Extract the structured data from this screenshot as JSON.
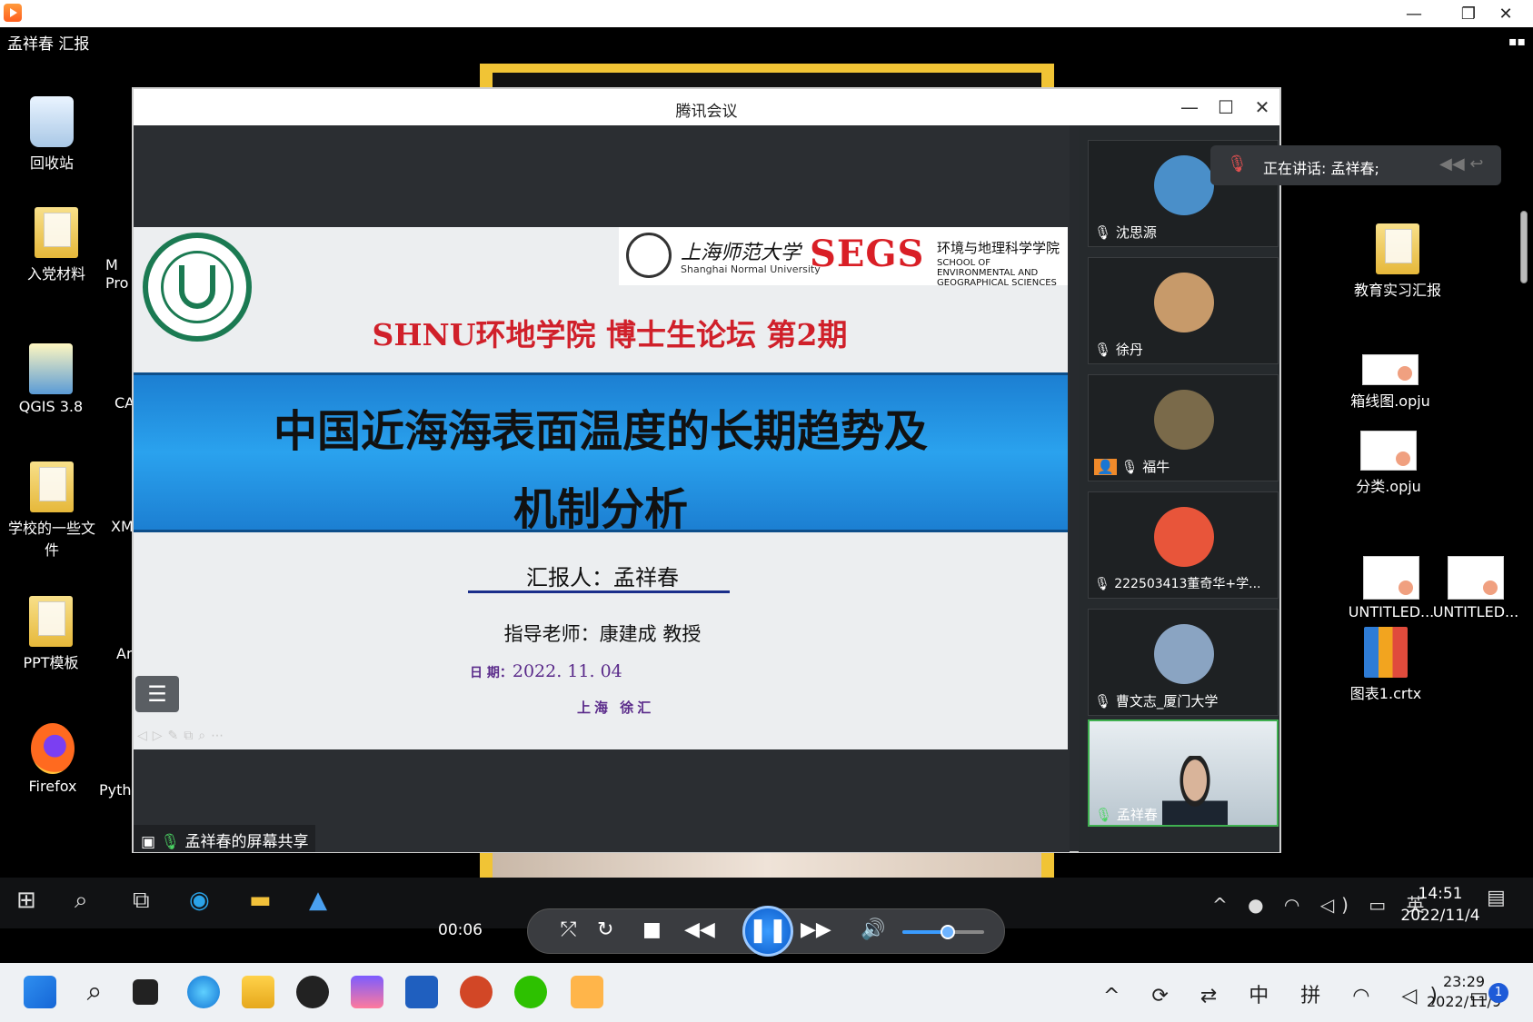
{
  "player": {
    "window_controls": [
      "—",
      "❐",
      "✕"
    ],
    "media_title": "孟祥春 汇报",
    "elapsed": "00:06",
    "volume_level": 0.55
  },
  "desktop": {
    "left_icons": [
      "回收站",
      "入党材料",
      "QGIS 3.8",
      "学校的一些文件",
      "PPT模板",
      "Firefox"
    ],
    "partial_icons": [
      "M\nPro",
      "CA",
      "XM",
      "Ar",
      "Pyth"
    ],
    "right_icons": [
      "教育实习汇报",
      "箱线图.opju",
      "分类.opju",
      "UNTITLED...",
      "UNTITLED...",
      "图表1.crtx"
    ]
  },
  "meeting": {
    "title": "腾讯会议",
    "window_controls": [
      "—",
      "☐",
      "✕"
    ],
    "share_status": "孟祥春的屏幕共享",
    "speaking": "正在讲话: 孟祥春;",
    "participants": [
      {
        "name": "沈思源",
        "avatar_color": "#4a8fc9"
      },
      {
        "name": "徐丹",
        "avatar_color": "#c79a6a"
      },
      {
        "name": "福牛",
        "avatar_color": "#7a6a4a"
      },
      {
        "name": "222503413董奇华+学...",
        "avatar_color": "#e8553a"
      },
      {
        "name": "曹文志_厦门大学",
        "avatar_color": "#8aa4c2"
      }
    ],
    "host": {
      "name": "孟祥春"
    }
  },
  "slide": {
    "shnu_cn": "上海师范大学",
    "shnu_en": "Shanghai Normal University",
    "segs_logo": "SEGS",
    "segs_cn": "环境与地理科学学院",
    "segs_en": "SCHOOL OF ENVIRONMENTAL AND GEOGRAPHICAL SCIENCES",
    "forum_title": "SHNU环地学院  博士生论坛 第2期",
    "title_line1": "中国近海海表面温度的长期趋势及",
    "title_line2": "机制分析",
    "reporter": "汇报人：孟祥春",
    "advisor": "指导老师：康建成  教授",
    "date_label": "日 期：",
    "date": "2022. 11. 04",
    "place": "上海  徐汇",
    "menu_icon": "☰",
    "toolbar_icons": "◁▷✎⧉⌕⋯"
  },
  "inner_taskbar": {
    "time": "14:51",
    "date": "2022/11/4",
    "tray": "^ ● ◠ ◁) ▭ 英"
  },
  "host_taskbar": {
    "time": "23:29",
    "date": "2022/11/9",
    "tray": "^ ⟳ ⇄ 中 拼 ◠ ◁) ▭",
    "notification_count": "1"
  }
}
